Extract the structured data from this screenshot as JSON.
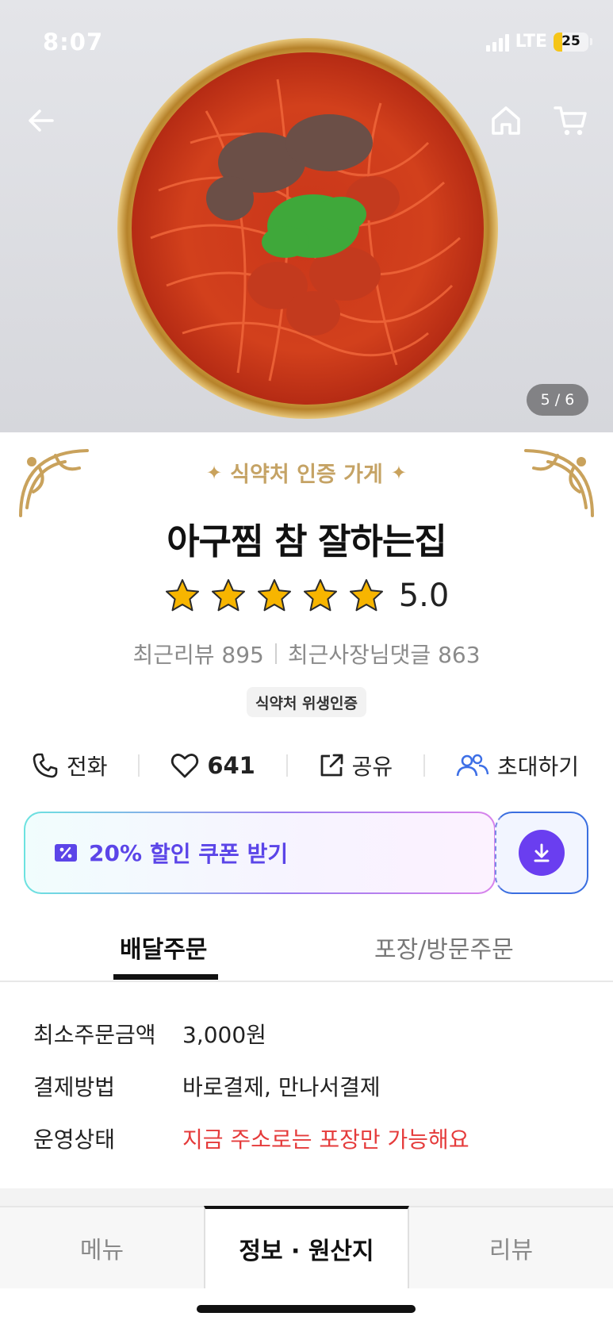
{
  "status_bar": {
    "time": "8:07",
    "network": "LTE",
    "battery": "25",
    "battery_level": 0.25
  },
  "hero": {
    "image_counter": "5 / 6"
  },
  "icons": {
    "back": "back-arrow-icon",
    "home": "home-icon",
    "cart": "cart-icon",
    "phone": "phone-icon",
    "heart": "heart-icon",
    "share": "share-icon",
    "invite": "people-icon",
    "coupon": "coupon-percent-icon",
    "download": "download-icon"
  },
  "store": {
    "certification_banner": "식약처 인증 가게",
    "name": "아구찜 참 잘하는집",
    "rating_stars": 5,
    "rating_value": "5.0",
    "recent_reviews": "최근리뷰 895",
    "owner_replies": "최근사장님댓글 863",
    "hygiene_badge": "식약처 위생인증"
  },
  "actions": {
    "call": "전화",
    "likes": "641",
    "share": "공유",
    "invite": "초대하기"
  },
  "coupon": {
    "percent": "20%",
    "label": "할인 쿠폰 받기"
  },
  "order_tabs": {
    "delivery": "배달주문",
    "pickup": "포장/방문주문"
  },
  "info_rows": [
    {
      "key": "최소주문금액",
      "value": "3,000원"
    },
    {
      "key": "결제방법",
      "value": "바로결제, 만나서결제"
    },
    {
      "key": "운영상태",
      "value": "지금 주소로는 포장만 가능해요"
    }
  ],
  "bottom_tabs": {
    "menu": "메뉴",
    "info": "정보 · 원산지",
    "reviews": "리뷰"
  },
  "colors": {
    "accent_purple": "#5b45e8",
    "gold": "#c5a365",
    "warning_red": "#e53b3b",
    "star_yellow": "#f7b500"
  }
}
